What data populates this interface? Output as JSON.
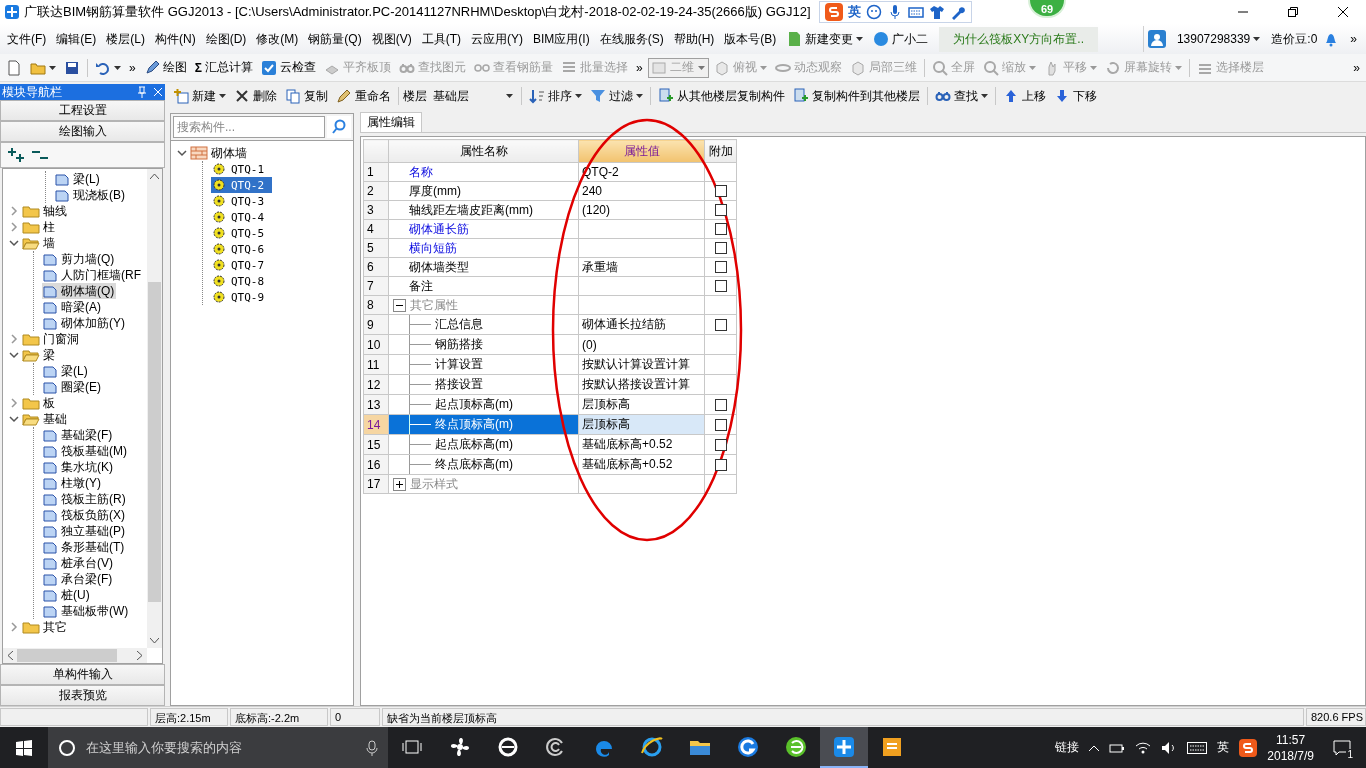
{
  "window": {
    "title": "广联达BIM钢筋算量软件 GGJ2013 - [C:\\Users\\Administrator.PC-20141127NRHM\\Desktop\\白龙村-2018-02-02-19-24-35(2666版) GGJ12]"
  },
  "ime_bar": {
    "mode": "英"
  },
  "score_badge": "69",
  "menu": [
    "文件(F)",
    "编辑(E)",
    "楼层(L)",
    "构件(N)",
    "绘图(D)",
    "修改(M)",
    "钢筋量(Q)",
    "视图(V)",
    "工具(T)",
    "云应用(Y)",
    "BIM应用(I)",
    "在线服务(S)",
    "帮助(H)",
    "版本号(B)"
  ],
  "menu_extras": {
    "new_change": "新建变更",
    "assistant": "广小二",
    "news": "为什么筏板XY方向布置..",
    "user": "13907298339",
    "beans": "造价豆:0",
    "more": "»"
  },
  "toolbar": [
    {
      "kind": "new"
    },
    {
      "kind": "open",
      "dropdown": true
    },
    {
      "kind": "save"
    },
    {
      "kind": "sep"
    },
    {
      "kind": "undo",
      "dropdown": true
    },
    {
      "kind": "chevron",
      "label": "»"
    },
    {
      "kind": "draw",
      "label": "绘图",
      "disabled": false
    },
    {
      "kind": "sum",
      "glyph": "Σ",
      "label": "汇总计算",
      "disabled": false
    },
    {
      "kind": "check",
      "label": "云检查",
      "disabled": false
    },
    {
      "kind": "flat",
      "label": "平齐板顶",
      "disabled": true
    },
    {
      "kind": "find",
      "label": "查找图元",
      "disabled": true
    },
    {
      "kind": "rebar",
      "label": "查看钢筋量",
      "disabled": true
    },
    {
      "kind": "batch",
      "label": "批量选择",
      "disabled": true
    },
    {
      "kind": "chevron",
      "label": "»"
    },
    {
      "kind": "select",
      "label": "二维",
      "disabled": true
    },
    {
      "kind": "top",
      "label": "俯视",
      "disabled": true,
      "dropdown": true
    },
    {
      "kind": "orbit",
      "label": "动态观察",
      "disabled": true
    },
    {
      "kind": "local3d",
      "label": "局部三维",
      "disabled": true
    },
    {
      "kind": "sep"
    },
    {
      "kind": "fullscreen",
      "label": "全屏",
      "disabled": true
    },
    {
      "kind": "zoom",
      "label": "缩放",
      "disabled": true,
      "dropdown": true
    },
    {
      "kind": "pan",
      "label": "平移",
      "disabled": true,
      "dropdown": true
    },
    {
      "kind": "rotate",
      "label": "屏幕旋转",
      "disabled": true,
      "dropdown": true
    },
    {
      "kind": "sep"
    },
    {
      "kind": "floor",
      "label": "选择楼层",
      "disabled": true
    },
    {
      "kind": "end",
      "label": "»"
    }
  ],
  "nav": {
    "title": "模块导航栏",
    "top_buttons": [
      "工程设置",
      "绘图输入"
    ],
    "bottom_buttons": [
      "单构件输入",
      "报表预览"
    ]
  },
  "nav_tree": [
    {
      "expanded": true,
      "children": [
        {
          "label": "梁(L)",
          "selected": false
        },
        {
          "label": "现浇板(B)",
          "selected": false
        }
      ]
    },
    {
      "label": "轴线",
      "expanded": false,
      "selected": false
    },
    {
      "label": "柱",
      "expanded": false,
      "selected": false
    },
    {
      "label": "墙",
      "expanded": true,
      "selected": false,
      "children": [
        {
          "label": "剪力墙(Q)",
          "selected": false
        },
        {
          "label": "人防门框墙(RF",
          "selected": false
        },
        {
          "label": "砌体墙(Q)",
          "selected": true
        },
        {
          "label": "暗梁(A)",
          "selected": false
        },
        {
          "label": "砌体加筋(Y)",
          "selected": false
        }
      ]
    },
    {
      "label": "门窗洞",
      "expanded": false,
      "selected": false
    },
    {
      "label": "梁",
      "expanded": true,
      "selected": false,
      "children": [
        {
          "label": "梁(L)",
          "selected": false
        },
        {
          "label": "圈梁(E)",
          "selected": false
        }
      ]
    },
    {
      "label": "板",
      "expanded": false,
      "selected": false
    },
    {
      "label": "基础",
      "expanded": true,
      "selected": false,
      "children": [
        {
          "label": "基础梁(F)",
          "selected": false
        },
        {
          "label": "筏板基础(M)",
          "selected": false
        },
        {
          "label": "集水坑(K)",
          "selected": false
        },
        {
          "label": "柱墩(Y)",
          "selected": false
        },
        {
          "label": "筏板主筋(R)",
          "selected": false
        },
        {
          "label": "筏板负筋(X)",
          "selected": false
        },
        {
          "label": "独立基础(P)",
          "selected": false
        },
        {
          "label": "条形基础(T)",
          "selected": false
        },
        {
          "label": "桩承台(V)",
          "selected": false
        },
        {
          "label": "承台梁(F)",
          "selected": false
        },
        {
          "label": "桩(U)",
          "selected": false
        },
        {
          "label": "基础板带(W)",
          "selected": false
        }
      ]
    },
    {
      "label": "其它",
      "expanded": false,
      "selected": false
    }
  ],
  "toolbar2": [
    {
      "kind": "new",
      "label": "新建",
      "dropdown": true
    },
    {
      "kind": "delete",
      "label": "删除"
    },
    {
      "kind": "copy",
      "label": "复制"
    },
    {
      "kind": "rename",
      "label": "重命名"
    },
    {
      "kind": "sep"
    },
    {
      "kind": "text",
      "label": "楼层"
    },
    {
      "kind": "floor_select",
      "label": "基础层"
    },
    {
      "kind": "sep"
    },
    {
      "kind": "sort",
      "label": "排序",
      "dropdown": true
    },
    {
      "kind": "filter",
      "label": "过滤",
      "dropdown": true
    },
    {
      "kind": "sep"
    },
    {
      "kind": "copy_from",
      "label": "从其他楼层复制构件"
    },
    {
      "kind": "copy_to",
      "label": "复制构件到其他楼层"
    },
    {
      "kind": "sep"
    },
    {
      "kind": "find",
      "label": "查找",
      "dropdown": true
    },
    {
      "kind": "sep"
    },
    {
      "kind": "up",
      "label": "上移"
    },
    {
      "kind": "down",
      "label": "下移"
    }
  ],
  "component_search": {
    "placeholder": "搜索构件..."
  },
  "component_tree": {
    "label": "砌体墙",
    "expanded": true,
    "children": [
      {
        "label": "QTQ-1",
        "selected": false
      },
      {
        "label": "QTQ-2",
        "selected": true
      },
      {
        "label": "QTQ-3",
        "selected": false
      },
      {
        "label": "QTQ-4",
        "selected": false
      },
      {
        "label": "QTQ-5",
        "selected": false
      },
      {
        "label": "QTQ-6",
        "selected": false
      },
      {
        "label": "QTQ-7",
        "selected": false
      },
      {
        "label": "QTQ-8",
        "selected": false
      },
      {
        "label": "QTQ-9",
        "selected": false
      }
    ]
  },
  "property_tabs": [
    {
      "label": "属性编辑",
      "selected": true
    }
  ],
  "property_table": {
    "columns": [
      {
        "label": "属性名称",
        "selected": false
      },
      {
        "label": "属性值",
        "selected": true
      },
      {
        "label": "附加",
        "selected": false
      }
    ],
    "rows": [
      {
        "no": "1",
        "name": "名称",
        "value": "QTQ-2",
        "kind": "link",
        "selected": false
      },
      {
        "no": "2",
        "name": "厚度(mm)",
        "value": "240",
        "kind": "plain",
        "selected": false,
        "checked": false
      },
      {
        "no": "3",
        "name": "轴线距左墙皮距离(mm)",
        "value": "(120)",
        "kind": "plain",
        "selected": false,
        "checked": false
      },
      {
        "no": "4",
        "name": "砌体通长筋",
        "kind": "link",
        "selected": false,
        "checked": false
      },
      {
        "no": "5",
        "name": "横向短筋",
        "kind": "link",
        "selected": false,
        "checked": false
      },
      {
        "no": "6",
        "name": "砌体墙类型",
        "value": "承重墙",
        "kind": "plain",
        "selected": false,
        "checked": false
      },
      {
        "no": "7",
        "name": "备注",
        "kind": "plain",
        "selected": false,
        "checked": false
      },
      {
        "no": "8",
        "name": "其它属性",
        "kind": "group",
        "expanded": true,
        "selected": false
      },
      {
        "no": "9",
        "name": "汇总信息",
        "value": "砌体通长拉结筋",
        "kind": "child",
        "selected": false,
        "checked": false
      },
      {
        "no": "10",
        "name": "钢筋搭接",
        "value": "(0)",
        "kind": "child",
        "selected": false
      },
      {
        "no": "11",
        "name": "计算设置",
        "value": "按默认计算设置计算",
        "kind": "child",
        "selected": false
      },
      {
        "no": "12",
        "name": "搭接设置",
        "value": "按默认搭接设置计算",
        "kind": "child",
        "selected": false
      },
      {
        "no": "13",
        "name": "起点顶标高(m)",
        "value": "层顶标高",
        "kind": "child",
        "selected": false,
        "checked": false
      },
      {
        "no": "14",
        "name": "终点顶标高(m)",
        "value": "层顶标高",
        "kind": "child",
        "selected": true,
        "checked": false
      },
      {
        "no": "15",
        "name": "起点底标高(m)",
        "value": "基础底标高+0.52",
        "kind": "child",
        "selected": false,
        "checked": false
      },
      {
        "no": "16",
        "name": "终点底标高(m)",
        "value": "基础底标高+0.52",
        "kind": "child",
        "selected": false,
        "checked": false
      },
      {
        "no": "17",
        "name": "显示样式",
        "kind": "group",
        "expanded": false,
        "selected": false
      }
    ]
  },
  "status_bar": [
    "层高:2.15m",
    "底标高:-2.2m",
    "0",
    "缺省为当前楼层顶标高",
    "820.6 FPS"
  ],
  "taskbar": {
    "search_placeholder": "在这里输入你要搜索的内容",
    "apps": [
      {
        "kind": "fan",
        "active": false
      },
      {
        "kind": "ie_old",
        "active": false
      },
      {
        "kind": "spiral",
        "active": false
      },
      {
        "kind": "edge",
        "active": false
      },
      {
        "kind": "ie",
        "active": false
      },
      {
        "kind": "folder",
        "active": false
      },
      {
        "kind": "g_app",
        "active": false
      },
      {
        "kind": "green_e",
        "active": false
      },
      {
        "kind": "glodon",
        "active": true
      },
      {
        "kind": "notes",
        "active": false
      }
    ],
    "links": "链接",
    "ime": "英",
    "time": "11:57",
    "date": "2018/7/9",
    "notifications": "1"
  }
}
